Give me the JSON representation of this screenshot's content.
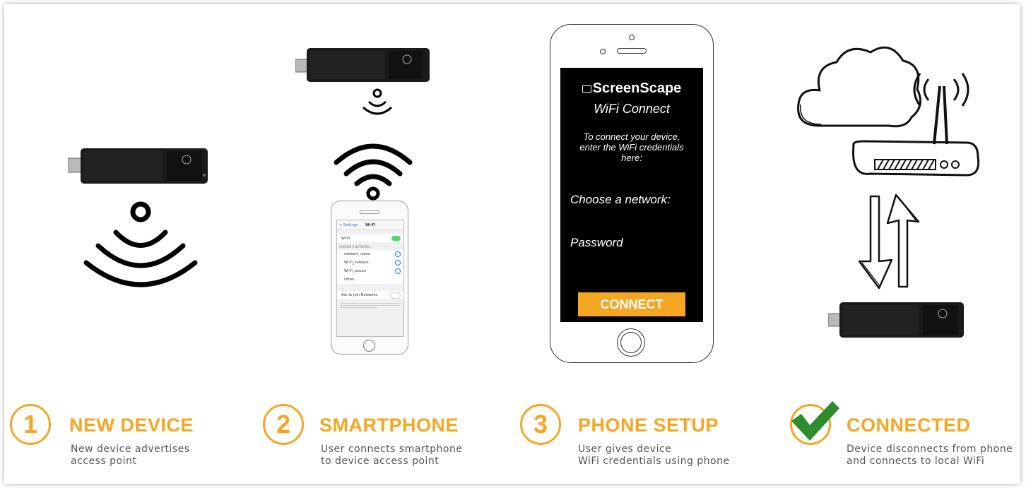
{
  "colors": {
    "accent": "#f5a623",
    "check": "#2e8b2e",
    "screen": "#000000"
  },
  "phone_app": {
    "brand": "ScreenScape",
    "subtitle": "WiFi Connect",
    "instructions_1": "To connect your device,",
    "instructions_2": "enter the WiFi credentials",
    "instructions_3": "here:",
    "network_label": "Choose a network:",
    "password_label": "Password",
    "connect_button": "CONNECT"
  },
  "mini_phone": {
    "back": "< Settings",
    "title": "Wi-Fi",
    "wifi_row": "Wi-Fi",
    "section": "CHOOSE A NETWORK...",
    "networks": [
      "network_name",
      "Wi-Fi_network",
      "Wi-Fi_secure",
      "Other..."
    ],
    "ask_row": "Ask to Join Networks"
  },
  "steps": [
    {
      "number": "1",
      "title": "NEW DEVICE",
      "desc_1": "New device advertises",
      "desc_2": "access point"
    },
    {
      "number": "2",
      "title": "SMARTPHONE",
      "desc_1": "User connects smartphone",
      "desc_2": "to device access point"
    },
    {
      "number": "3",
      "title": "PHONE SETUP",
      "desc_1": "User gives device",
      "desc_2": "WiFi credentials using phone"
    },
    {
      "number": "",
      "title": "CONNECTED",
      "desc_1": "Device disconnects from phone",
      "desc_2": "and connects to local WiFi"
    }
  ]
}
